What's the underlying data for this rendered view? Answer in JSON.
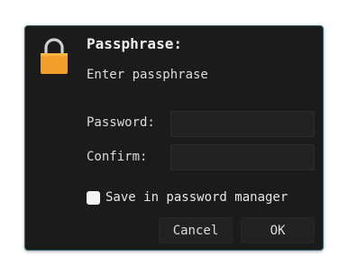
{
  "dialog": {
    "title": "Passphrase:",
    "description": "Enter passphrase",
    "icon": "lock-icon",
    "accent_color": "#f0a02a",
    "border_color": "#3c6a78"
  },
  "fields": {
    "password": {
      "label": "Password:",
      "value": "",
      "placeholder": ""
    },
    "confirm": {
      "label": "Confirm:",
      "value": "",
      "placeholder": ""
    }
  },
  "save_option": {
    "label": "Save in password manager",
    "checked": false
  },
  "buttons": {
    "cancel": "Cancel",
    "ok": "OK"
  }
}
